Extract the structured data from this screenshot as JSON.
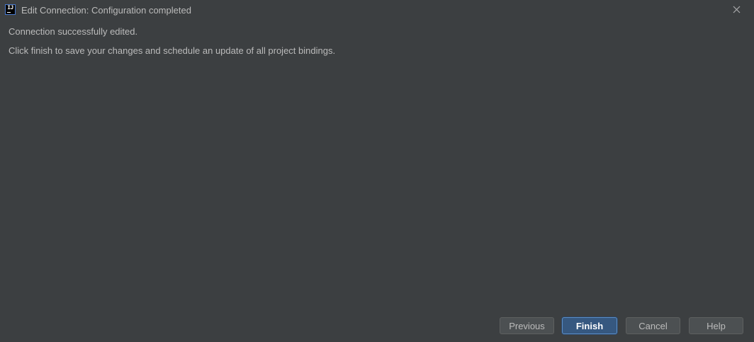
{
  "window": {
    "title": "Edit Connection: Configuration completed",
    "app_icon": "intellij-app-icon",
    "app_icon_glyph": "IJ",
    "close_icon": "close-icon"
  },
  "content": {
    "message": "Connection successfully edited.",
    "instruction": "Click finish to save your changes and schedule an update of all project bindings."
  },
  "buttons": {
    "previous": "Previous",
    "finish": "Finish",
    "cancel": "Cancel",
    "help": "Help"
  },
  "colors": {
    "background": "#3c3f41",
    "text": "#bbbbbb",
    "primary_button": "#365880",
    "primary_button_border": "#5a8ec8",
    "button": "#4c5052"
  }
}
